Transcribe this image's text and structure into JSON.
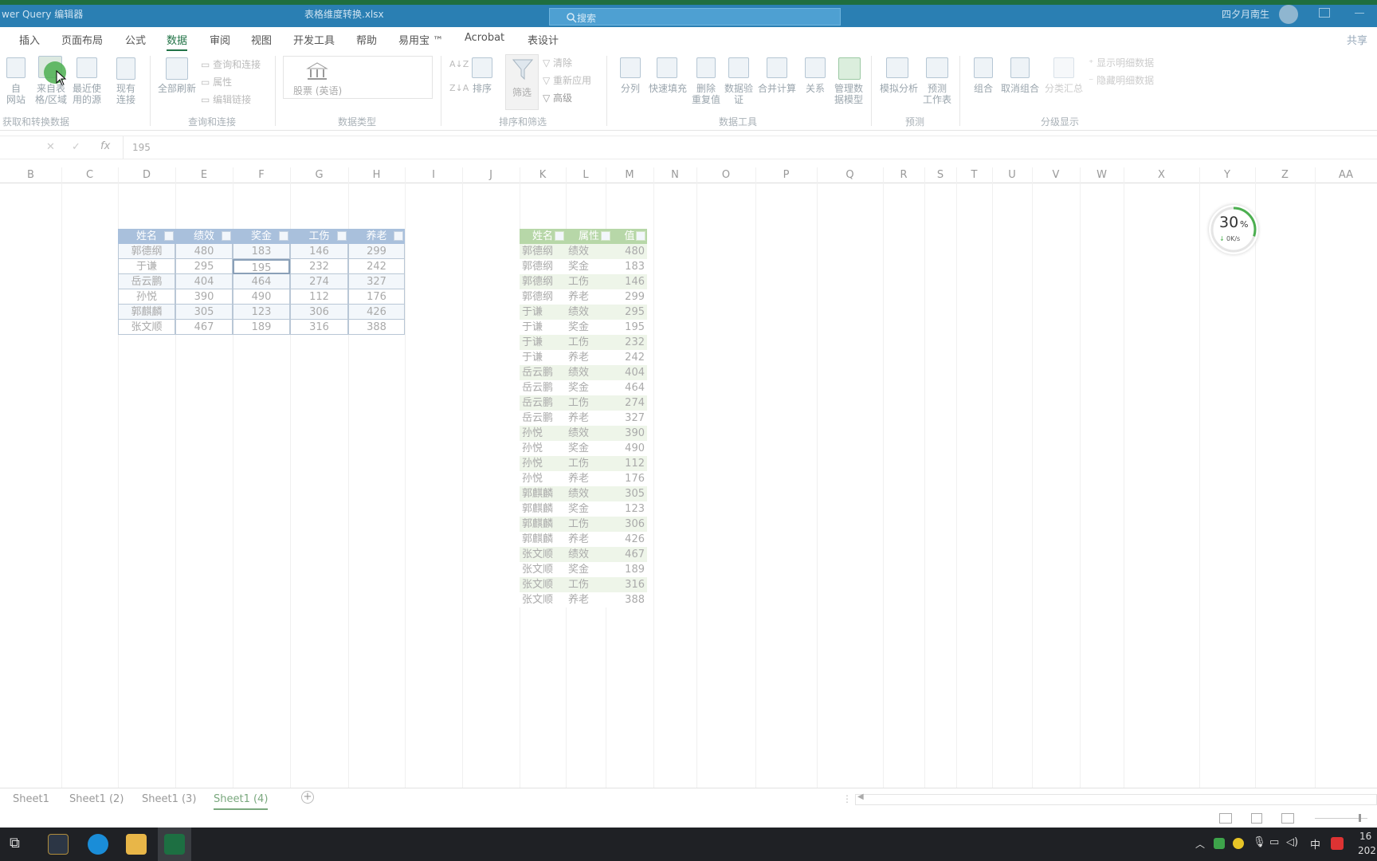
{
  "titlebar": {
    "app_label": "wer Query 编辑器",
    "file_name": "表格维度转换.xlsx",
    "search_placeholder": "搜索",
    "user_name": "四夕月南生"
  },
  "tabs": [
    "插入",
    "页面布局",
    "公式",
    "数据",
    "审阅",
    "视图",
    "开发工具",
    "帮助",
    "易用宝 ™",
    "Acrobat",
    "表设计"
  ],
  "active_tab": "数据",
  "share_label": "共享",
  "ribbon": {
    "group_get": {
      "label": "获取和转换数据",
      "from_web": "自\n网站",
      "from_table": "来自表\n格/区域",
      "recent": "最近使\n用的源",
      "existing": "现有\n连接"
    },
    "group_query": {
      "label": "查询和连接",
      "refresh_all": "全部刷新",
      "queries_connections": "查询和连接",
      "properties": "属性",
      "edit_links": "编辑链接"
    },
    "group_datatype": {
      "label": "数据类型",
      "stocks": "股票 (英语)"
    },
    "group_sort": {
      "label": "排序和筛选",
      "sort": "排序",
      "filter": "筛选",
      "clear": "清除",
      "reapply": "重新应用",
      "advanced": "高级"
    },
    "group_tools": {
      "label": "数据工具",
      "split": "分列",
      "flash_fill": "快速填充",
      "remove_dup": "删除\n重复值",
      "validation": "数据验\n证",
      "consolidate": "合并计算",
      "relations": "关系",
      "data_model": "管理数\n据模型"
    },
    "group_forecast": {
      "label": "预测",
      "whatif": "模拟分析",
      "forecast_sheet": "预测\n工作表"
    },
    "group_outline": {
      "label": "分级显示",
      "group": "组合",
      "ungroup": "取消组合",
      "subtotal": "分类汇总",
      "show_detail": "显示明细数据",
      "hide_detail": "隐藏明细数据"
    }
  },
  "formula": {
    "value": "195"
  },
  "columns": [
    "B",
    "C",
    "D",
    "E",
    "F",
    "G",
    "H",
    "I",
    "J",
    "K",
    "L",
    "M",
    "N",
    "O",
    "P",
    "Q",
    "R",
    "S",
    "T",
    "U",
    "V",
    "W",
    "X",
    "Y",
    "Z",
    "AA"
  ],
  "table1": {
    "headers": [
      "姓名",
      "绩效",
      "奖金",
      "工伤",
      "养老"
    ],
    "rows": [
      [
        "郭德纲",
        "480",
        "183",
        "146",
        "299"
      ],
      [
        "于谦",
        "295",
        "195",
        "232",
        "242"
      ],
      [
        "岳云鹏",
        "404",
        "464",
        "274",
        "327"
      ],
      [
        "孙悦",
        "390",
        "490",
        "112",
        "176"
      ],
      [
        "郭麒麟",
        "305",
        "123",
        "306",
        "426"
      ],
      [
        "张文顺",
        "467",
        "189",
        "316",
        "388"
      ]
    ]
  },
  "table2": {
    "headers": [
      "姓名",
      "属性",
      "值"
    ],
    "rows": [
      [
        "郭德纲",
        "绩效",
        "480"
      ],
      [
        "郭德纲",
        "奖金",
        "183"
      ],
      [
        "郭德纲",
        "工伤",
        "146"
      ],
      [
        "郭德纲",
        "养老",
        "299"
      ],
      [
        "于谦",
        "绩效",
        "295"
      ],
      [
        "于谦",
        "奖金",
        "195"
      ],
      [
        "于谦",
        "工伤",
        "232"
      ],
      [
        "于谦",
        "养老",
        "242"
      ],
      [
        "岳云鹏",
        "绩效",
        "404"
      ],
      [
        "岳云鹏",
        "奖金",
        "464"
      ],
      [
        "岳云鹏",
        "工伤",
        "274"
      ],
      [
        "岳云鹏",
        "养老",
        "327"
      ],
      [
        "孙悦",
        "绩效",
        "390"
      ],
      [
        "孙悦",
        "奖金",
        "490"
      ],
      [
        "孙悦",
        "工伤",
        "112"
      ],
      [
        "孙悦",
        "养老",
        "176"
      ],
      [
        "郭麒麟",
        "绩效",
        "305"
      ],
      [
        "郭麒麟",
        "奖金",
        "123"
      ],
      [
        "郭麒麟",
        "工伤",
        "306"
      ],
      [
        "郭麒麟",
        "养老",
        "426"
      ],
      [
        "张文顺",
        "绩效",
        "467"
      ],
      [
        "张文顺",
        "奖金",
        "189"
      ],
      [
        "张文顺",
        "工伤",
        "316"
      ],
      [
        "张文顺",
        "养老",
        "388"
      ]
    ]
  },
  "net_widget": {
    "percent": "30",
    "percent_unit": "%",
    "speed": "0K/s"
  },
  "sheets": [
    "Sheet1",
    "Sheet1 (2)",
    "Sheet1 (3)",
    "Sheet1 (4)"
  ],
  "active_sheet": "Sheet1 (4)",
  "taskbar": {
    "ime": "中",
    "clock_top": "16",
    "clock_bottom": "202"
  }
}
